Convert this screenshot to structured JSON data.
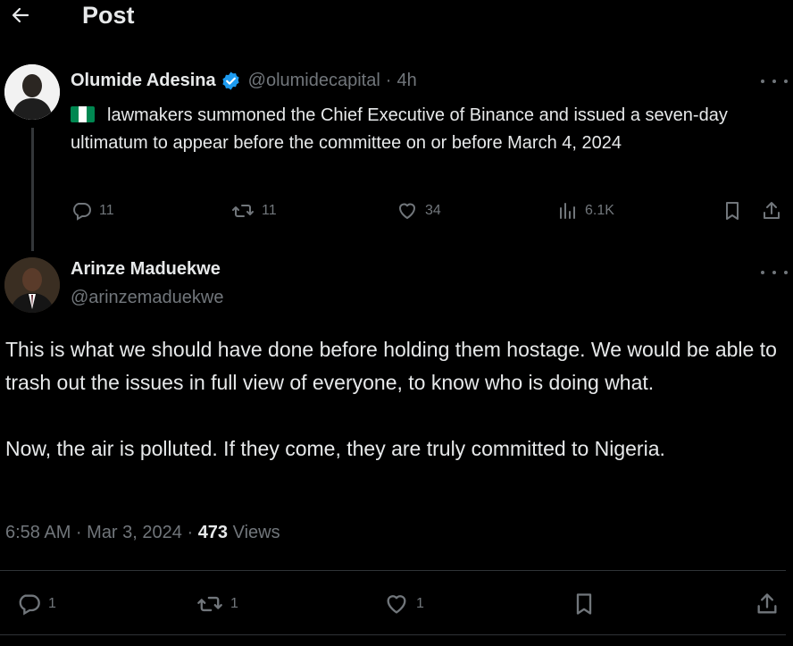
{
  "header": {
    "title": "Post",
    "back_icon": "arrow-left-icon"
  },
  "quoted_post": {
    "author_name": "Olumide Adesina",
    "handle": "@olumidecapital",
    "separator": "·",
    "time": "4h",
    "verified_color": "#1d9bf0",
    "flag_colors": [
      "#008751",
      "#ffffff",
      "#008751"
    ],
    "text": "lawmakers summoned the Chief Executive of Binance and issued a seven-day ultimatum to appear before the committee on or before March 4, 2024",
    "replies": "11",
    "reposts": "11",
    "likes": "34",
    "views": "6.1K"
  },
  "main_post": {
    "author_name": "Arinze Maduekwe",
    "handle": "@arinzemaduekwe",
    "text": "This is what we should have done before holding them hostage. We would be able to trash out the issues in full view of everyone, to know who is doing what.\n\nNow, the air is polluted. If they come, they are truly committed to Nigeria.",
    "timestamp": "6:58 AM · Mar 3, 2024",
    "dot": "·",
    "views_count": "473",
    "views_label": "Views",
    "replies": "1",
    "reposts": "1",
    "likes": "1"
  },
  "colors": {
    "background": "#000000",
    "text": "#e7e9ea",
    "muted": "#71767b",
    "divider": "#2f3336"
  }
}
